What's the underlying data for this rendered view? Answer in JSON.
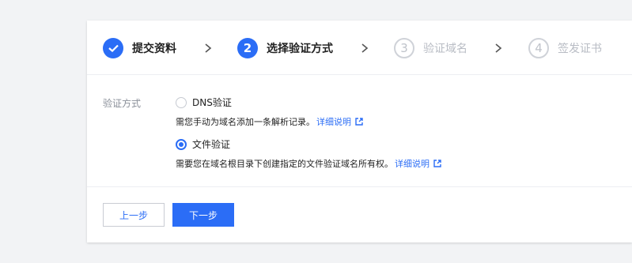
{
  "steps": [
    {
      "number": "",
      "label": "提交资料",
      "state": "done"
    },
    {
      "number": "2",
      "label": "选择验证方式",
      "state": "active"
    },
    {
      "number": "3",
      "label": "验证域名",
      "state": "todo"
    },
    {
      "number": "4",
      "label": "签发证书",
      "state": "todo"
    }
  ],
  "form": {
    "label": "验证方式",
    "options": [
      {
        "label": "DNS验证",
        "checked": false,
        "description": "需您手动为域名添加一条解析记录。",
        "link": "详细说明"
      },
      {
        "label": "文件验证",
        "checked": true,
        "description": "需要您在域名根目录下创建指定的文件验证域名所有权。",
        "link": "详细说明"
      }
    ]
  },
  "buttons": {
    "prev": "上一步",
    "next": "下一步"
  },
  "colors": {
    "accent": "#2b6df6",
    "background": "#f2f3f5"
  }
}
